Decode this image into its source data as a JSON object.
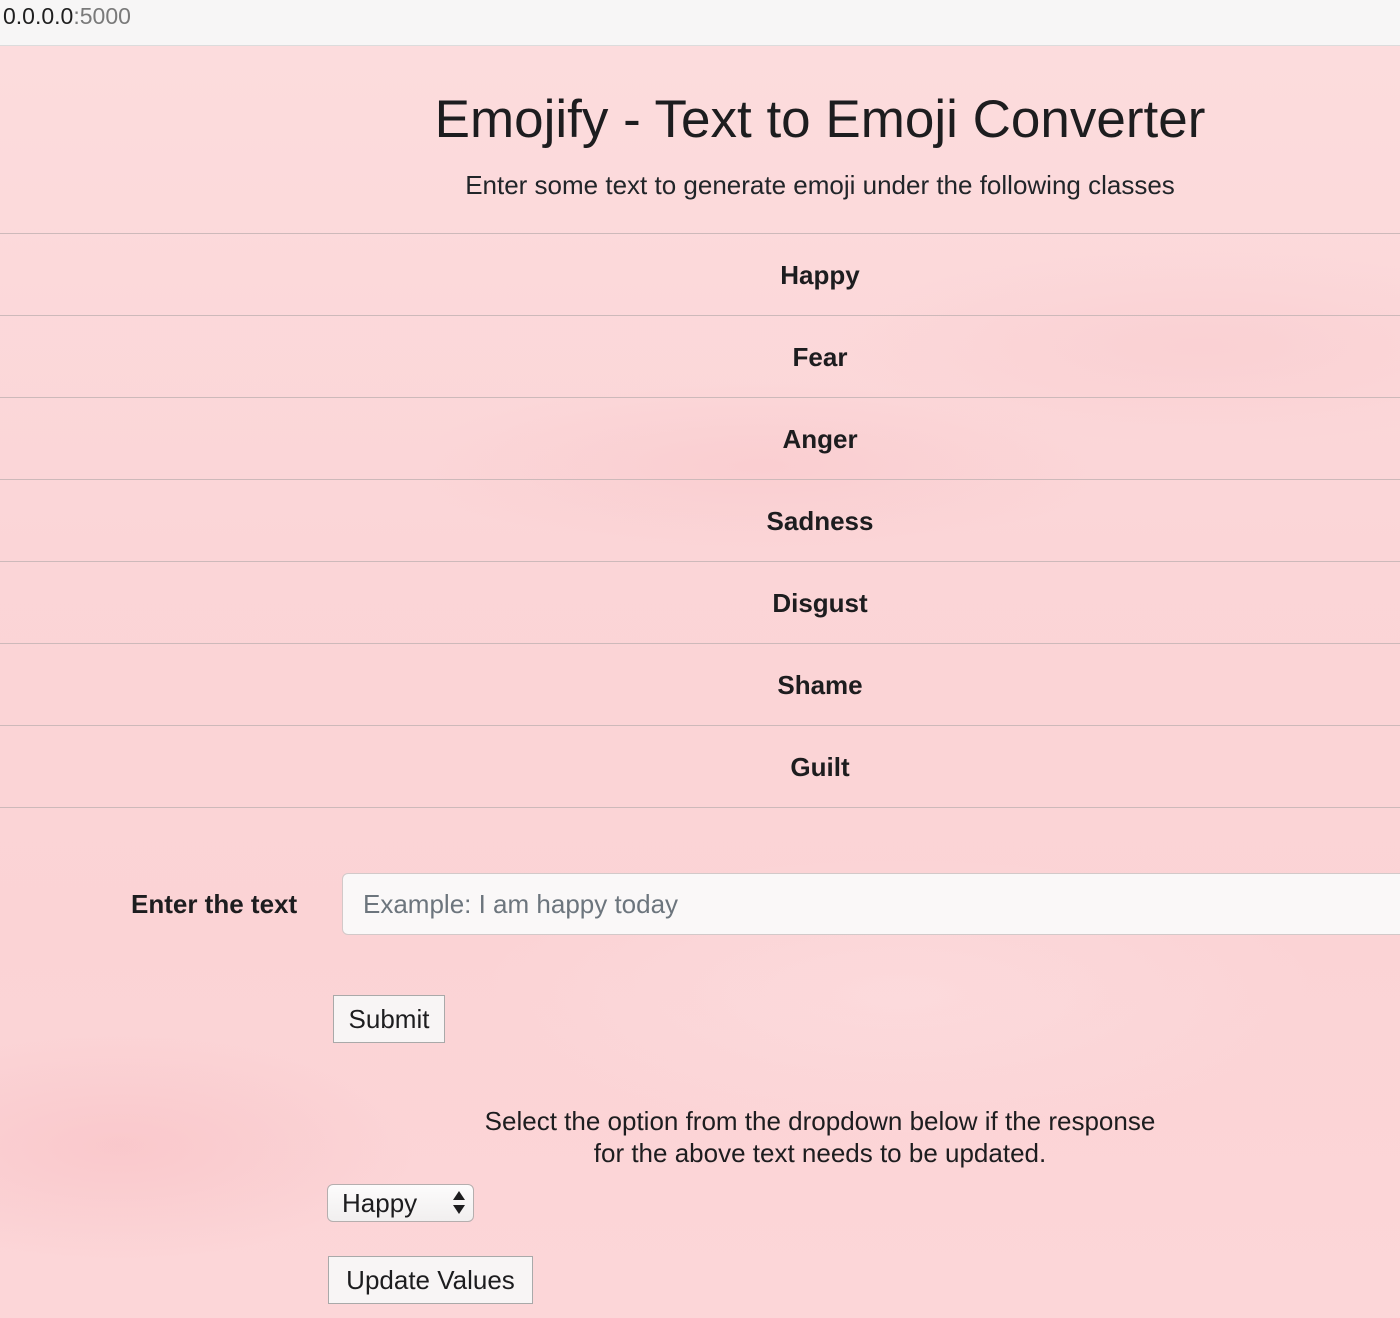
{
  "address_bar": {
    "host": "0.0.0.0",
    "port": ":5000"
  },
  "header": {
    "title": "Emojify - Text to Emoji Converter",
    "subtitle": "Enter some text to generate emoji under the following classes"
  },
  "classes": [
    {
      "label": "Happy"
    },
    {
      "label": "Fear"
    },
    {
      "label": "Anger"
    },
    {
      "label": "Sadness"
    },
    {
      "label": "Disgust"
    },
    {
      "label": "Shame"
    },
    {
      "label": "Guilt"
    }
  ],
  "form": {
    "text_label": "Enter the text",
    "text_value": "",
    "text_placeholder": "Example: I am happy today",
    "submit_label": "Submit"
  },
  "update": {
    "instructions_line1": "Select the option from the dropdown below if the response",
    "instructions_line2": "for the above text needs to be updated.",
    "selected_option": "Happy",
    "button_label": "Update Values"
  },
  "colors": {
    "background": "#fbd6d8",
    "divider": "#cdb9ba"
  }
}
